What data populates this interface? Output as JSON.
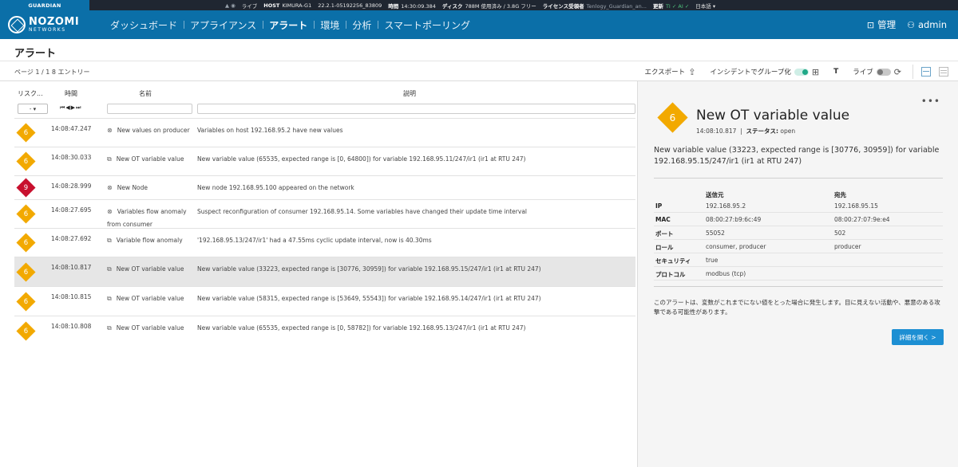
{
  "statusbar": {
    "product": "GUARDIAN",
    "live_label": "ライブ",
    "host_label": "HOST",
    "host_value": "KIMURA-G1",
    "version": "22.2.1-05192256_83809",
    "time_label": "時間",
    "time_value": "14:30:09.384",
    "disk_label": "ディスク",
    "disk_value": "788M 使用済み / 3.8G フリー",
    "license_label": "ライセンス受領者",
    "license_value": "Tenlogy_Guardian_an...",
    "update_label": "更新",
    "update_value": "TI ✓ AI ✓",
    "language": "日本語"
  },
  "brand": {
    "line1": "NOZOMI",
    "line2": "NETWORKS"
  },
  "nav": {
    "items": [
      {
        "label": "ダッシュボード",
        "active": false
      },
      {
        "label": "アプライアンス",
        "active": false
      },
      {
        "label": "アラート",
        "active": true
      },
      {
        "label": "環境",
        "active": false
      },
      {
        "label": "分析",
        "active": false
      },
      {
        "label": "スマートポーリング",
        "active": false
      }
    ],
    "admin_label": "管理",
    "user_label": "admin"
  },
  "page": {
    "title": "アラート",
    "count": "ページ 1 / 1 8 エントリー"
  },
  "toolbar": {
    "export_label": "エクスポート",
    "group_label": "インシデントでグループ化",
    "filter_icon": "T",
    "live_label": "ライブ"
  },
  "table": {
    "headers": {
      "risk": "リスク...",
      "time": "時間",
      "name": "名前",
      "desc": "説明"
    },
    "risk_filter": "- ▾",
    "pager": "⏮◀▶⏭",
    "rows": [
      {
        "risk": "6",
        "time": "14:08:47.247",
        "icon": "⊗",
        "name": "New values on producer",
        "desc": "Variables on host 192.168.95.2 have new values"
      },
      {
        "risk": "6",
        "time": "14:08:30.033",
        "icon": "⧉",
        "name": "New OT variable value",
        "desc": "New variable value (65535, expected range is [0, 64800]) for variable 192.168.95.11/247/ir1 (ir1 at RTU 247)"
      },
      {
        "risk": "9",
        "time": "14:08:28.999",
        "icon": "⊗",
        "name": "New Node",
        "desc": "New node 192.168.95.100 appeared on the network"
      },
      {
        "risk": "6",
        "time": "14:08:27.695",
        "icon": "⊗",
        "name": "Variables flow anomaly from consumer",
        "desc": "Suspect reconfiguration of consumer 192.168.95.14. Some variables have changed their update time interval"
      },
      {
        "risk": "6",
        "time": "14:08:27.692",
        "icon": "⧉",
        "name": "Variable flow anomaly",
        "desc": "'192.168.95.13/247/ir1' had a 47.55ms cyclic update interval, now is 40.30ms"
      },
      {
        "risk": "6",
        "time": "14:08:10.817",
        "icon": "⧉",
        "name": "New OT variable value",
        "desc": "New variable value (33223, expected range is [30776, 30959]) for variable 192.168.95.15/247/ir1 (ir1 at RTU 247)"
      },
      {
        "risk": "6",
        "time": "14:08:10.815",
        "icon": "⧉",
        "name": "New OT variable value",
        "desc": "New variable value (58315, expected range is [53649, 55543]) for variable 192.168.95.14/247/ir1 (ir1 at RTU 247)"
      },
      {
        "risk": "6",
        "time": "14:08:10.808",
        "icon": "⧉",
        "name": "New OT variable value",
        "desc": "New variable value (65535, expected range is [0, 58782]) for variable 192.168.95.13/247/ir1 (ir1 at RTU 247)"
      }
    ]
  },
  "detail": {
    "risk": "6",
    "title": "New OT variable value",
    "time": "14:08:10.817",
    "status_label": "ステータス:",
    "status_value": "open",
    "description": "New variable value (33223, expected range is [30776, 30959]) for variable 192.168.95.15/247/ir1 (ir1 at RTU 247)",
    "src_header": "送信元",
    "dst_header": "宛先",
    "fields": [
      {
        "key": "IP",
        "src": "192.168.95.2",
        "dst": "192.168.95.15"
      },
      {
        "key": "MAC",
        "src": "08:00:27:b9:6c:49",
        "dst": "08:00:27:07:9e:e4"
      },
      {
        "key": "ポート",
        "src": "55052",
        "dst": "502"
      },
      {
        "key": "ロール",
        "src": "consumer, producer",
        "dst": "producer"
      },
      {
        "key": "セキュリティ",
        "src": "true",
        "dst": ""
      },
      {
        "key": "プロトコル",
        "src": "modbus (tcp)",
        "dst": ""
      }
    ],
    "note": "このアラートは、変数がこれまでにない値をとった場合に発生します。目に見えない活動や、悪意のある攻撃である可能性があります。",
    "button": "詳細を開く >"
  },
  "colors": {
    "risk_6": "#f2a900",
    "risk_9": "#c8102e",
    "nav_bg": "#0b6fa8"
  }
}
